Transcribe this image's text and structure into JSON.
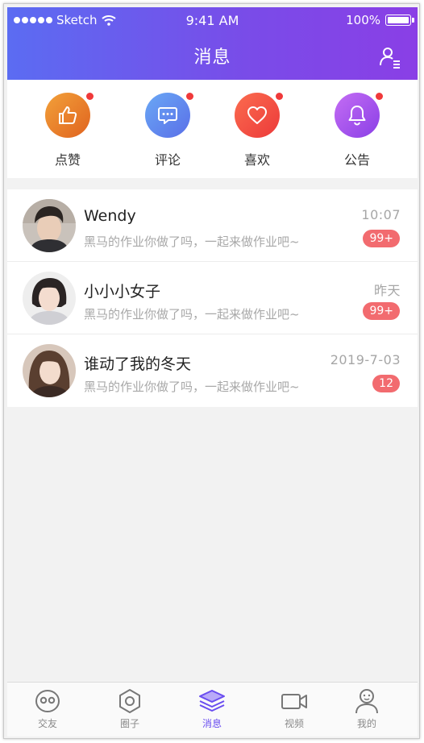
{
  "status_bar": {
    "carrier": "Sketch",
    "time": "9:41 AM",
    "battery": "100%"
  },
  "header": {
    "title": "消息"
  },
  "quick_actions": [
    {
      "label": "点赞",
      "icon": "thumbs-up-icon",
      "color_from": "#f2a13a",
      "color_to": "#e0631f",
      "has_dot": true
    },
    {
      "label": "评论",
      "icon": "comment-icon",
      "color_from": "#6aa8f5",
      "color_to": "#5a6fe8",
      "has_dot": true
    },
    {
      "label": "喜欢",
      "icon": "heart-icon",
      "color_from": "#fb6c4f",
      "color_to": "#ec3a3a",
      "has_dot": true
    },
    {
      "label": "公告",
      "icon": "bell-icon",
      "color_from": "#c46df4",
      "color_to": "#8a3fe6",
      "has_dot": true
    }
  ],
  "messages": [
    {
      "name": "Wendy",
      "preview": "黑马的作业你做了吗，一起来做作业吧~",
      "time": "10:07",
      "badge": "99+"
    },
    {
      "name": "小小小女子",
      "preview": "黑马的作业你做了吗，一起来做作业吧~",
      "time": "昨天",
      "badge": "99+"
    },
    {
      "name": "谁动了我的冬天",
      "preview": "黑马的作业你做了吗，一起来做作业吧~",
      "time": "2019-7-03",
      "badge": "12"
    }
  ],
  "tabs": [
    {
      "label": "交友",
      "icon": "friends-icon",
      "active": false
    },
    {
      "label": "圈子",
      "icon": "circle-icon",
      "active": false
    },
    {
      "label": "消息",
      "icon": "message-layers-icon",
      "active": true
    },
    {
      "label": "视频",
      "icon": "video-icon",
      "active": false
    },
    {
      "label": "我的",
      "icon": "profile-icon",
      "active": false
    }
  ],
  "colors": {
    "accent": "#6a4df0",
    "badge": "#f26b6f",
    "dot": "#f0393a"
  }
}
